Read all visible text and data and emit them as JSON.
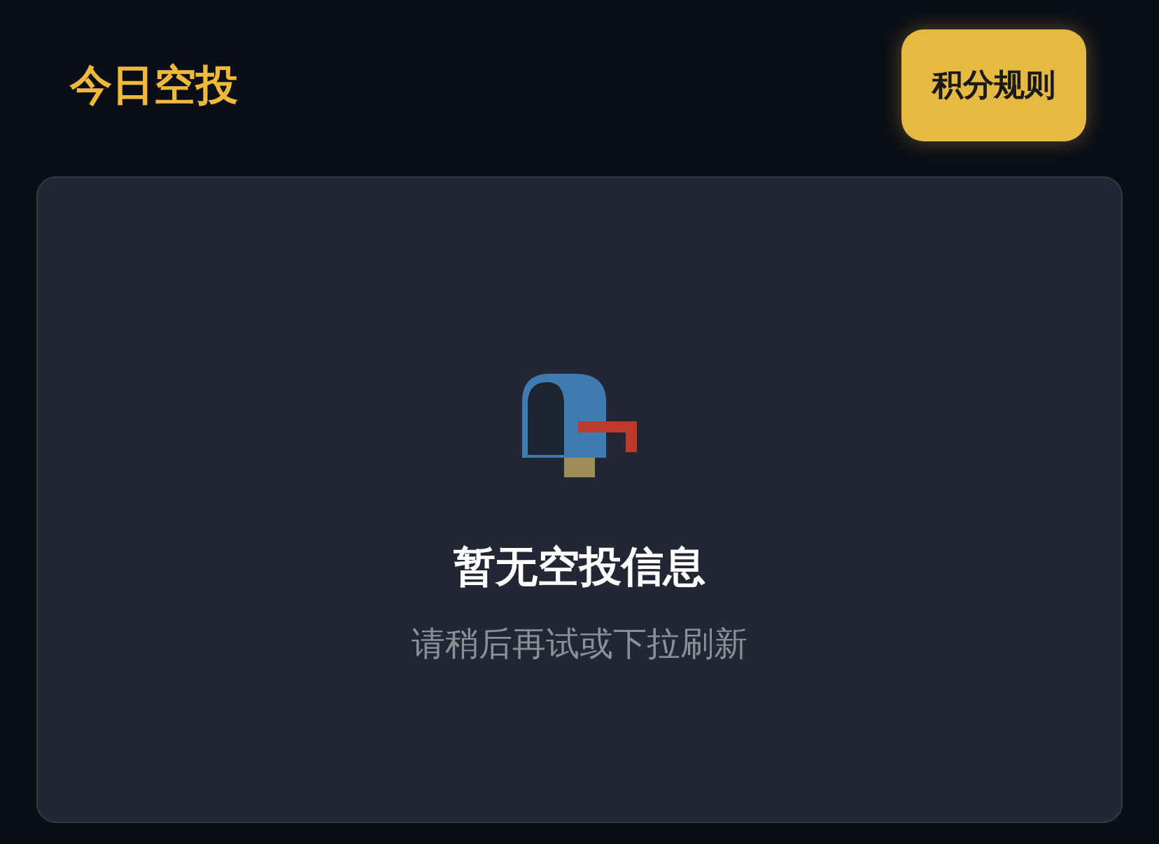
{
  "header": {
    "title": "今日空投",
    "rules_button": "积分规则"
  },
  "empty_state": {
    "title": "暂无空投信息",
    "hint": "请稍后再试或下拉刷新"
  }
}
